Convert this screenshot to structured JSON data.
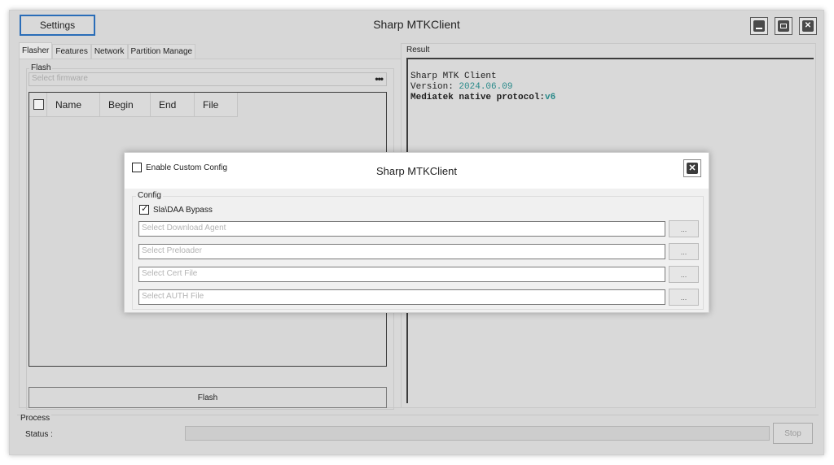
{
  "window": {
    "title": "Sharp MTKClient",
    "settings_label": "Settings"
  },
  "tabs": [
    {
      "label": "Flasher"
    },
    {
      "label": "Features"
    },
    {
      "label": "Network"
    },
    {
      "label": "Partition Manage"
    }
  ],
  "flash": {
    "group_label": "Flash",
    "firmware_placeholder": "Select firmware",
    "browse_label": "•••",
    "columns": [
      "Name",
      "Begin",
      "End",
      "File"
    ],
    "button_label": "Flash"
  },
  "result": {
    "label": "Result",
    "line1": "Sharp MTK Client",
    "line2_key": "Version: ",
    "line2_value": "2024.06.09",
    "line3_key": "Mediatek native protocol:",
    "line3_value": "v6"
  },
  "process": {
    "label": "Process",
    "status_label": "Status :",
    "stop_label": "Stop"
  },
  "modal": {
    "title": "Sharp MTKClient",
    "enable_label": "Enable Custom Config",
    "config_label": "Config",
    "bypass_label": "Sla\\DAA Bypass",
    "bypass_checked": true,
    "browse_label": "...",
    "fields": [
      {
        "placeholder": "Select Download Agent"
      },
      {
        "placeholder": "Select Preloader"
      },
      {
        "placeholder": "Select Cert File"
      },
      {
        "placeholder": "Select AUTH File"
      }
    ]
  },
  "colors": {
    "accent": "#2a6db8",
    "value_text": "#2a8a8a"
  }
}
